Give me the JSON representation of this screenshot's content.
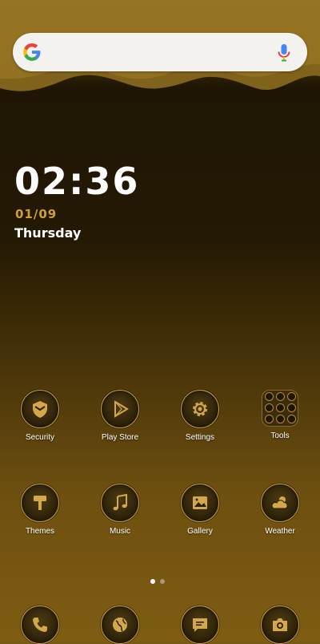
{
  "search": {
    "placeholder": ""
  },
  "clock": {
    "time": "02:36",
    "date": "01/09",
    "weekday": "Thursday"
  },
  "home_apps": [
    {
      "label": "Security",
      "icon": "shield-icon"
    },
    {
      "label": "Play Store",
      "icon": "play-icon"
    },
    {
      "label": "Settings",
      "icon": "gear-icon"
    },
    {
      "label": "Tools",
      "icon": "folder-icon"
    },
    {
      "label": "Themes",
      "icon": "paint-roller-icon"
    },
    {
      "label": "Music",
      "icon": "music-note-icon"
    },
    {
      "label": "Gallery",
      "icon": "image-icon"
    },
    {
      "label": "Weather",
      "icon": "cloud-sun-icon"
    }
  ],
  "dock_apps": [
    {
      "icon": "phone-icon"
    },
    {
      "icon": "globe-icon"
    },
    {
      "icon": "message-icon"
    },
    {
      "icon": "camera-icon"
    }
  ],
  "page_indicator": {
    "pages": 2,
    "current": 1
  },
  "colors": {
    "accent": "#c9a04a",
    "date": "#d0a035",
    "icon_glyph": "#d4a84a"
  }
}
